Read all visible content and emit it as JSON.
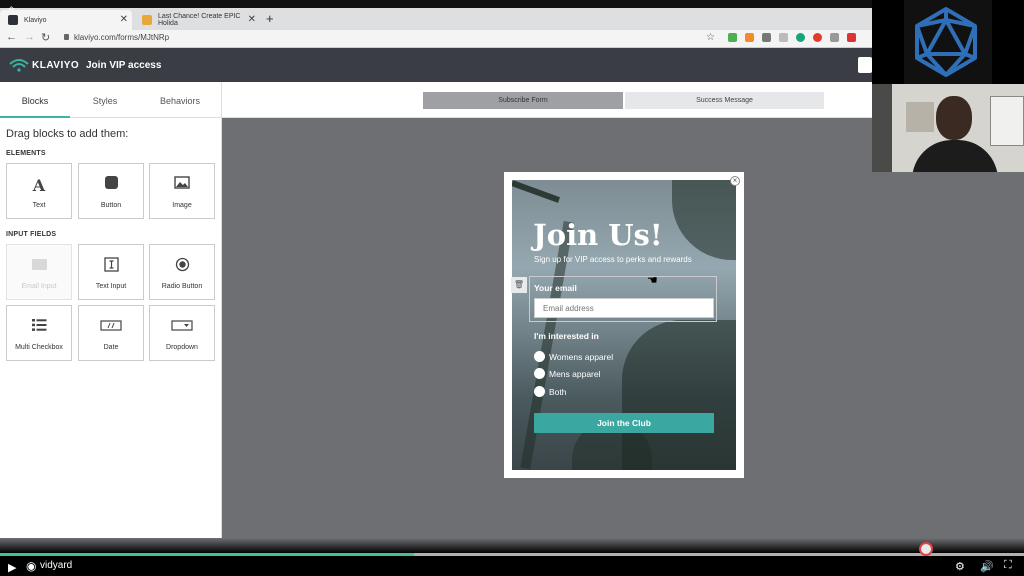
{
  "browser": {
    "tabs": [
      {
        "label": "Klaviyo",
        "active": true
      },
      {
        "label": "Last Chance! Create EPIC Holida",
        "active": false
      }
    ],
    "new_tab": "+",
    "url": "klaviyo.com/forms/MJtNRp"
  },
  "app": {
    "logo": "KLAVIYO",
    "title": "Join VIP access",
    "accent": "#3bb3a6"
  },
  "sidebar": {
    "tabs": [
      "Blocks",
      "Styles",
      "Behaviors"
    ],
    "drag_title": "Drag blocks to add them:",
    "elements_label": "ELEMENTS",
    "elements": [
      {
        "label": "Text",
        "icon": "text-icon"
      },
      {
        "label": "Button",
        "icon": "button-icon"
      },
      {
        "label": "Image",
        "icon": "image-icon"
      }
    ],
    "input_fields_label": "INPUT FIELDS",
    "input_fields": [
      {
        "label": "Email Input",
        "icon": "envelope-icon",
        "disabled": true
      },
      {
        "label": "Text Input",
        "icon": "text-input-icon"
      },
      {
        "label": "Radio Button",
        "icon": "radio-icon"
      },
      {
        "label": "Multi Checkbox",
        "icon": "list-icon"
      },
      {
        "label": "Date",
        "icon": "date-icon"
      },
      {
        "label": "Dropdown",
        "icon": "dropdown-icon"
      }
    ]
  },
  "view_toggle": {
    "subscribe": "Subscribe Form",
    "success": "Success Message"
  },
  "form": {
    "title": "Join Us!",
    "subtitle": "Sign up for VIP access to perks and rewards",
    "email_label": "Your email",
    "email_placeholder": "Email address",
    "interest_label": "I'm interested in",
    "options": [
      "Womens apparel",
      "Mens apparel",
      "Both"
    ],
    "button": "Join the Club",
    "button_color": "#3aa7a0"
  },
  "player": {
    "brand": "vidyard",
    "progress": 0.404
  }
}
